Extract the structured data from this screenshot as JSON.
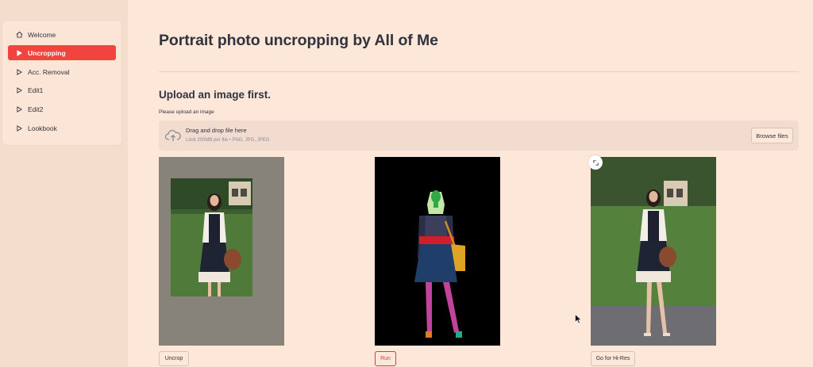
{
  "sidebar": {
    "items": [
      {
        "label": "Welcome",
        "icon": "home-icon",
        "active": false
      },
      {
        "label": "Uncropping",
        "icon": "play-icon",
        "active": true
      },
      {
        "label": "Acc. Removal",
        "icon": "play-icon",
        "active": false
      },
      {
        "label": "Edit1",
        "icon": "play-icon",
        "active": false
      },
      {
        "label": "Edit2",
        "icon": "play-icon",
        "active": false
      },
      {
        "label": "Lookbook",
        "icon": "play-icon",
        "active": false
      }
    ]
  },
  "main": {
    "title": "Portrait photo uncropping by All of Me",
    "subtitle": "Upload an image first.",
    "upload": {
      "label": "Please upload an image",
      "drop_text": "Drag and drop file here",
      "limit_text": "Limit 200MB per file • PNG, JPG, JPEG",
      "browse_label": "Browse files"
    },
    "panels": [
      {
        "content": "cropped portrait photo on gray canvas",
        "button": "Uncrop"
      },
      {
        "content": "segmentation map",
        "button": "Run"
      },
      {
        "content": "uncropped full-body portrait",
        "button": "Go for Hi-Res"
      }
    ]
  },
  "colors": {
    "background": "#fde7d9",
    "sidebar": "#f5ddcd",
    "accent": "#f2443f",
    "text": "#31333f"
  }
}
